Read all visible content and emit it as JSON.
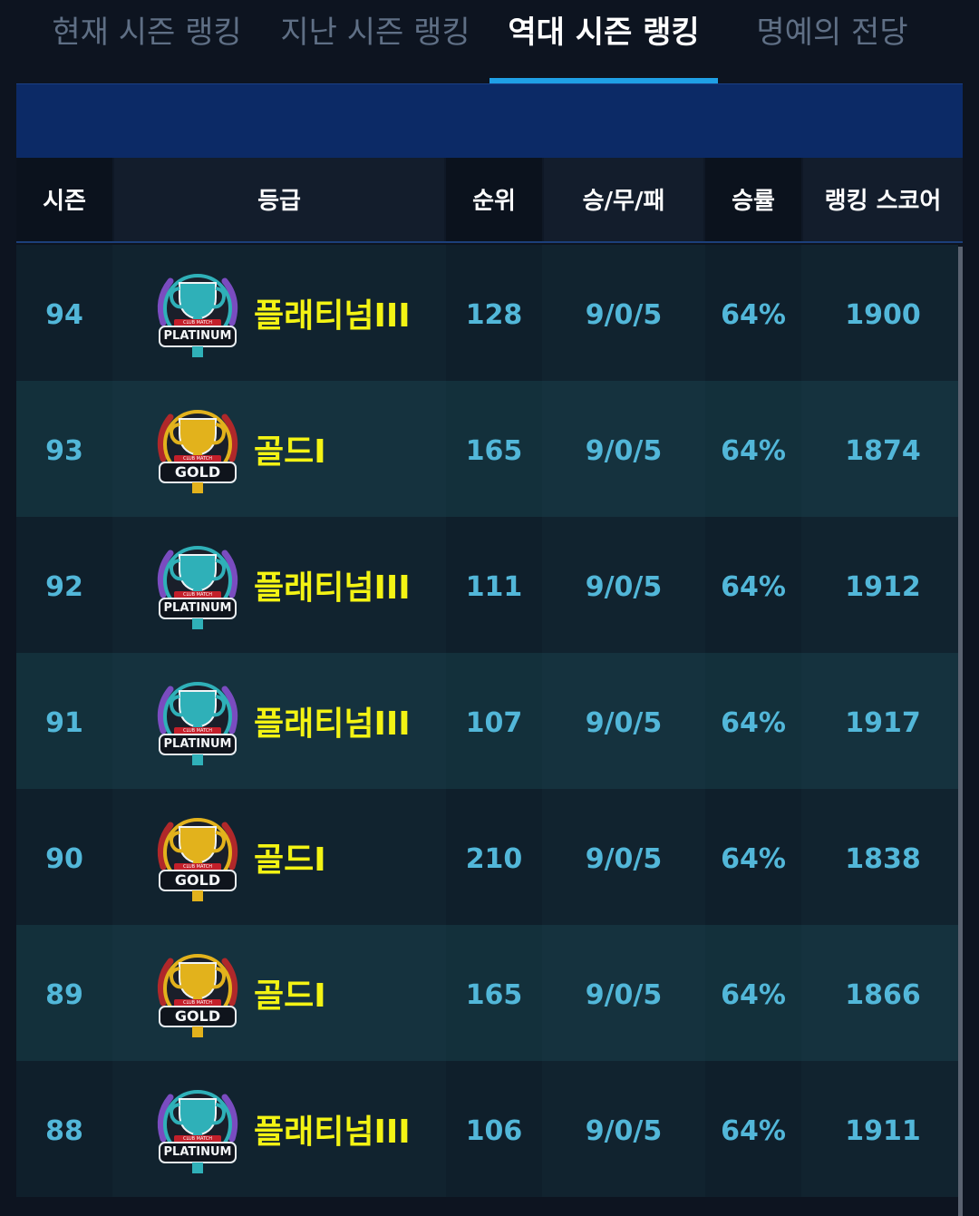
{
  "tabs": [
    {
      "label": "현재 시즌 랭킹",
      "active": false
    },
    {
      "label": "지난 시즌 랭킹",
      "active": false
    },
    {
      "label": "역대 시즌 랭킹",
      "active": true
    },
    {
      "label": "명예의 전당",
      "active": false
    }
  ],
  "table": {
    "headers": [
      "시즌",
      "등급",
      "순위",
      "승/무/패",
      "승률",
      "랭킹 스코어"
    ],
    "rows": [
      {
        "season": "94",
        "grade": "플래티넘III",
        "badge": "platinum",
        "rank": "128",
        "wdl": "9/0/5",
        "winrate": "64%",
        "score": "1900"
      },
      {
        "season": "93",
        "grade": "골드I",
        "badge": "gold",
        "rank": "165",
        "wdl": "9/0/5",
        "winrate": "64%",
        "score": "1874"
      },
      {
        "season": "92",
        "grade": "플래티넘III",
        "badge": "platinum",
        "rank": "111",
        "wdl": "9/0/5",
        "winrate": "64%",
        "score": "1912"
      },
      {
        "season": "91",
        "grade": "플래티넘III",
        "badge": "platinum",
        "rank": "107",
        "wdl": "9/0/5",
        "winrate": "64%",
        "score": "1917"
      },
      {
        "season": "90",
        "grade": "골드I",
        "badge": "gold",
        "rank": "210",
        "wdl": "9/0/5",
        "winrate": "64%",
        "score": "1838"
      },
      {
        "season": "89",
        "grade": "골드I",
        "badge": "gold",
        "rank": "165",
        "wdl": "9/0/5",
        "winrate": "64%",
        "score": "1866"
      },
      {
        "season": "88",
        "grade": "플래티넘III",
        "badge": "platinum",
        "rank": "106",
        "wdl": "9/0/5",
        "winrate": "64%",
        "score": "1911"
      }
    ]
  },
  "badges": {
    "platinum": {
      "text": "PLATINUM",
      "ribbon": "CLUB MATCH",
      "primary": "#2fb0b8",
      "secondary": "#7a4cc0"
    },
    "gold": {
      "text": "GOLD",
      "ribbon": "CLUB MATCH",
      "primary": "#e2b21c",
      "secondary": "#b0282a"
    }
  },
  "colors": {
    "accent": "#1fa0e6",
    "value_text": "#52b7d9",
    "grade_text": "#f3f314",
    "row_dark": "#11232f",
    "row_light": "#15323e"
  }
}
